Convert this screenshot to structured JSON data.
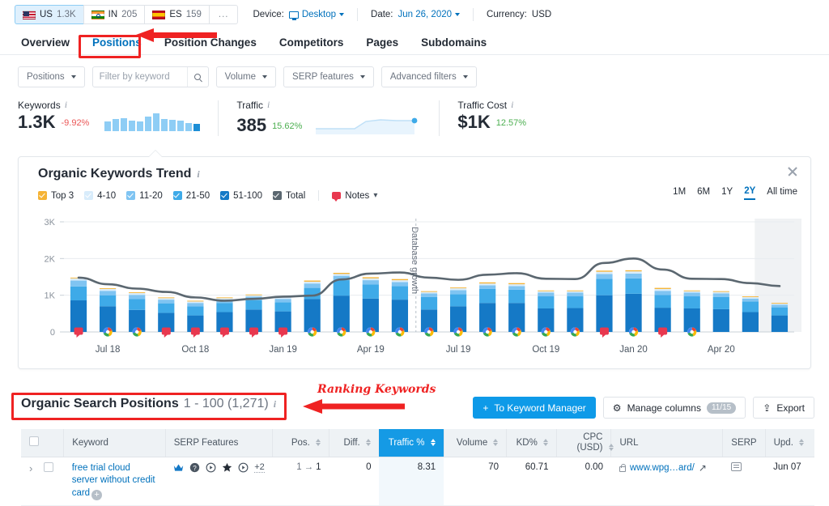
{
  "topbar": {
    "databases": [
      {
        "code": "US",
        "count": "1.3K",
        "flag": "us-flag-icon",
        "active": true
      },
      {
        "code": "IN",
        "count": "205",
        "flag": "in-flag-icon",
        "active": false
      },
      {
        "code": "ES",
        "count": "159",
        "flag": "es-flag-icon",
        "active": false
      }
    ],
    "more_label": "...",
    "device_label": "Device:",
    "device_value": "Desktop",
    "date_label": "Date:",
    "date_value": "Jun 26, 2020",
    "currency_label": "Currency:",
    "currency_value": "USD"
  },
  "nav": {
    "tabs": [
      {
        "label": "Overview",
        "active": false
      },
      {
        "label": "Positions",
        "active": true
      },
      {
        "label": "Position Changes",
        "active": false
      },
      {
        "label": "Competitors",
        "active": false
      },
      {
        "label": "Pages",
        "active": false
      },
      {
        "label": "Subdomains",
        "active": false
      }
    ]
  },
  "filters": {
    "positions": "Positions",
    "search_placeholder": "Filter by keyword",
    "search_value": "",
    "volume": "Volume",
    "serp_features": "SERP features",
    "advanced": "Advanced filters"
  },
  "metrics": [
    {
      "title": "Keywords",
      "value": "1.3K",
      "delta": "-9.92%",
      "delta_dir": "neg"
    },
    {
      "title": "Traffic",
      "value": "385",
      "delta": "15.62%",
      "delta_dir": "pos"
    },
    {
      "title": "Traffic Cost",
      "value": "$1K",
      "delta": "12.57%",
      "delta_dir": "pos"
    }
  ],
  "keywords_sparkline": [
    11,
    14,
    15,
    12,
    11,
    17,
    21,
    14,
    13,
    12,
    10,
    9
  ],
  "card": {
    "title": "Organic Keywords Trend",
    "legend": [
      {
        "label": "Top 3",
        "color": "#f5b335",
        "checked": true
      },
      {
        "label": "4-10",
        "color": "#d8ecfb",
        "checked": true
      },
      {
        "label": "11-20",
        "color": "#7fc4f2",
        "checked": true
      },
      {
        "label": "21-50",
        "color": "#3eaae8",
        "checked": true
      },
      {
        "label": "51-100",
        "color": "#1579c6",
        "checked": true
      },
      {
        "label": "Total",
        "color": "#5b6770",
        "checked": true
      }
    ],
    "notes_label": "Notes",
    "ranges": [
      {
        "label": "1M",
        "active": false
      },
      {
        "label": "6M",
        "active": false
      },
      {
        "label": "1Y",
        "active": false
      },
      {
        "label": "2Y",
        "active": true
      },
      {
        "label": "All time",
        "active": false
      }
    ],
    "database_growth_label": "Database growth"
  },
  "chart_data": {
    "type": "bar",
    "title": "Organic Keywords Trend",
    "xlabel": "",
    "ylabel": "",
    "ylim": [
      0,
      3000
    ],
    "yticks": [
      0,
      1000,
      2000,
      3000
    ],
    "ytick_labels": [
      "0",
      "1K",
      "2K",
      "3K"
    ],
    "grid": true,
    "stacked": true,
    "legend_position": "top-left",
    "x_tick_labels": [
      "Jul 18",
      "Oct 18",
      "Jan 19",
      "Apr 19",
      "Jul 19",
      "Oct 19",
      "Jan 20",
      "Apr 20"
    ],
    "x_tick_indices": [
      1,
      4,
      7,
      10,
      13,
      16,
      19,
      22
    ],
    "categories": [
      "Jun 18",
      "Jul 18",
      "Aug 18",
      "Sep 18",
      "Oct 18",
      "Nov 18",
      "Dec 18",
      "Jan 19",
      "Feb 19",
      "Mar 19",
      "Apr 19",
      "May 19",
      "Jun 19",
      "Jul 19",
      "Aug 19",
      "Sep 19",
      "Oct 19",
      "Nov 19",
      "Dec 19",
      "Jan 20",
      "Feb 20",
      "Mar 20",
      "Apr 20",
      "May 20",
      "Jun 20"
    ],
    "series": [
      {
        "name": "51-100",
        "color": "#1579c6",
        "values": [
          860,
          700,
          600,
          520,
          450,
          540,
          610,
          560,
          900,
          990,
          910,
          880,
          610,
          700,
          790,
          790,
          640,
          650,
          1000,
          1040,
          660,
          640,
          620,
          540,
          450
        ]
      },
      {
        "name": "21-50",
        "color": "#3eaae8",
        "values": [
          380,
          300,
          300,
          260,
          250,
          250,
          250,
          250,
          300,
          420,
          380,
          370,
          340,
          330,
          380,
          360,
          330,
          320,
          450,
          420,
          350,
          330,
          330,
          290,
          220
        ]
      },
      {
        "name": "11-20",
        "color": "#7fc4f2",
        "values": [
          160,
          120,
          110,
          100,
          90,
          90,
          100,
          90,
          120,
          120,
          120,
          110,
          100,
          110,
          100,
          100,
          100,
          100,
          130,
          130,
          110,
          100,
          100,
          80,
          70
        ]
      },
      {
        "name": "4-10",
        "color": "#d8ecfb",
        "values": [
          60,
          50,
          50,
          40,
          40,
          40,
          40,
          40,
          50,
          50,
          50,
          50,
          40,
          50,
          50,
          50,
          40,
          40,
          60,
          60,
          50,
          40,
          40,
          40,
          30
        ]
      },
      {
        "name": "Top 3",
        "color": "#f5b335",
        "values": [
          20,
          20,
          20,
          20,
          20,
          20,
          20,
          20,
          30,
          30,
          30,
          30,
          20,
          20,
          30,
          30,
          20,
          20,
          30,
          30,
          30,
          20,
          20,
          20,
          20
        ]
      }
    ],
    "total_line": {
      "name": "Total",
      "color": "#5b6770",
      "values": [
        1480,
        1300,
        1180,
        1090,
        940,
        850,
        900,
        960,
        990,
        1430,
        1590,
        1620,
        1480,
        1420,
        1560,
        1600,
        1450,
        1440,
        1880,
        2000,
        1700,
        1450,
        1440,
        1330,
        1250
      ]
    },
    "markers": [
      {
        "index": 0,
        "type": "note"
      },
      {
        "index": 1,
        "type": "google"
      },
      {
        "index": 2,
        "type": "google"
      },
      {
        "index": 3,
        "type": "note"
      },
      {
        "index": 4,
        "type": "note"
      },
      {
        "index": 5,
        "type": "note"
      },
      {
        "index": 6,
        "type": "note"
      },
      {
        "index": 7,
        "type": "note"
      },
      {
        "index": 8,
        "type": "google"
      },
      {
        "index": 9,
        "type": "google"
      },
      {
        "index": 10,
        "type": "google"
      },
      {
        "index": 11,
        "type": "google"
      },
      {
        "index": 12,
        "type": "google"
      },
      {
        "index": 13,
        "type": "google"
      },
      {
        "index": 14,
        "type": "google"
      },
      {
        "index": 15,
        "type": "google"
      },
      {
        "index": 16,
        "type": "google"
      },
      {
        "index": 17,
        "type": "google"
      },
      {
        "index": 18,
        "type": "note"
      },
      {
        "index": 19,
        "type": "google"
      },
      {
        "index": 20,
        "type": "note"
      },
      {
        "index": 21,
        "type": "google"
      }
    ]
  },
  "section": {
    "title": "Organic Search Positions",
    "subtitle": "1 - 100 (1,271)",
    "keyword_manager_btn": "To Keyword Manager",
    "manage_columns_btn": "Manage columns",
    "manage_columns_count": "11/15",
    "export_btn": "Export"
  },
  "table": {
    "columns": [
      {
        "label": "Keyword",
        "sortable": false,
        "align": "left"
      },
      {
        "label": "SERP Features",
        "sortable": false,
        "align": "left"
      },
      {
        "label": "Pos.",
        "sortable": true,
        "align": "right"
      },
      {
        "label": "Diff.",
        "sortable": true,
        "align": "right"
      },
      {
        "label": "Traffic %",
        "sortable": true,
        "align": "right",
        "active": true
      },
      {
        "label": "Volume",
        "sortable": true,
        "align": "right"
      },
      {
        "label": "KD%",
        "sortable": true,
        "align": "right"
      },
      {
        "label": "CPC (USD)",
        "sortable": true,
        "align": "right"
      },
      {
        "label": "URL",
        "sortable": false,
        "align": "left"
      },
      {
        "label": "SERP",
        "sortable": false,
        "align": "left"
      },
      {
        "label": "Upd.",
        "sortable": true,
        "align": "left"
      }
    ],
    "rows": [
      {
        "keyword": "free trial cloud server without credit card",
        "serp_features": [
          "crown-icon",
          "question-circle-icon",
          "play-circle-icon",
          "star-icon",
          "play-circle-icon"
        ],
        "serp_features_more": "+2",
        "pos_from": "1",
        "pos_to": "1",
        "diff": "0",
        "traffic_pct": "8.31",
        "volume": "70",
        "kd": "60.71",
        "cpc": "0.00",
        "url": "www.wpg…ard/",
        "updated": "Jun 07"
      }
    ]
  },
  "annotations": [
    {
      "name": "ranking-keywords-annotation",
      "text": "Ranking Keywords"
    }
  ]
}
